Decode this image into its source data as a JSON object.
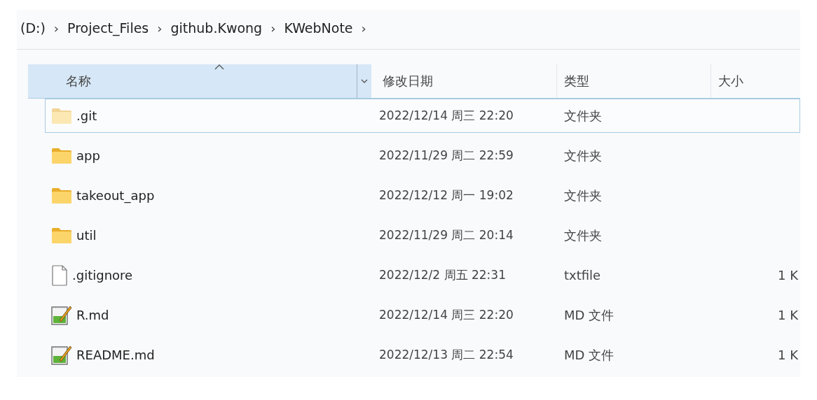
{
  "breadcrumb": {
    "items": [
      "(D:)",
      "Project_Files",
      "github.Kwong",
      "KWebNote"
    ],
    "separator": "›"
  },
  "table": {
    "columns": [
      {
        "label": "名称",
        "selected": true,
        "sorted": true
      },
      {
        "label": "修改日期",
        "selected": false
      },
      {
        "label": "类型",
        "selected": false
      },
      {
        "label": "大小",
        "selected": false
      }
    ],
    "rows": [
      {
        "kind": "folder",
        "hidden": true,
        "selected": true,
        "name": ".git",
        "modified": "2022/12/14 周三 22:20",
        "type": "文件夹"
      },
      {
        "kind": "folder",
        "hidden": false,
        "selected": false,
        "name": "app",
        "modified": "2022/11/29 周二 22:59",
        "type": "文件夹"
      },
      {
        "kind": "folder",
        "hidden": false,
        "selected": false,
        "name": "takeout_app",
        "modified": "2022/12/12 周一 19:02",
        "type": "文件夹"
      },
      {
        "kind": "folder",
        "hidden": false,
        "selected": false,
        "name": "util",
        "modified": "2022/11/29 周二 20:14",
        "type": "文件夹"
      },
      {
        "kind": "file",
        "hidden": false,
        "selected": false,
        "name": ".gitignore",
        "modified": "2022/12/2 周五 22:31",
        "type": "txtfile",
        "size": "1 K"
      },
      {
        "kind": "note",
        "hidden": false,
        "selected": false,
        "name": "R.md",
        "modified": "2022/12/14 周三 22:20",
        "type": "MD 文件",
        "size": "1 K"
      },
      {
        "kind": "note",
        "hidden": false,
        "selected": false,
        "name": "README.md",
        "modified": "2022/12/13 周二 22:54",
        "type": "MD 文件",
        "size": "1 K"
      }
    ]
  }
}
